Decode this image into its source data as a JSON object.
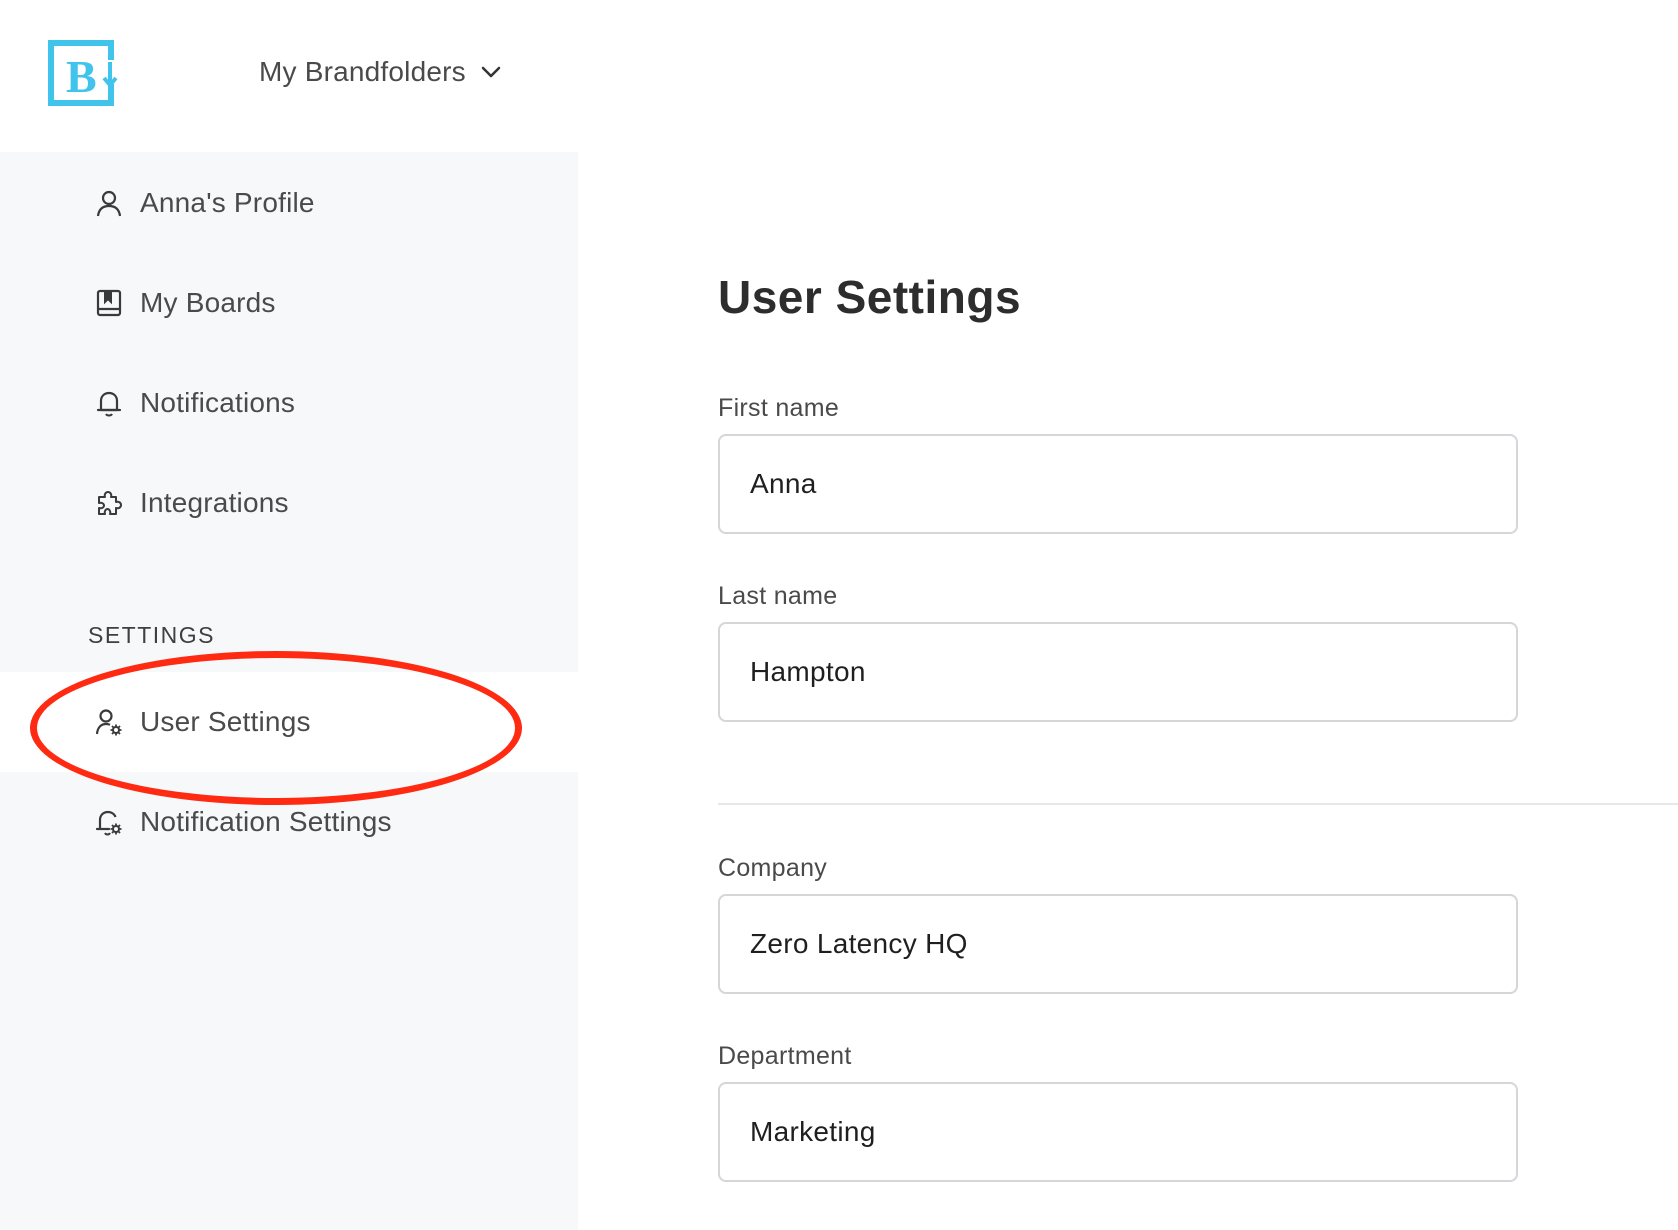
{
  "header": {
    "brand_switcher_label": "My Brandfolders"
  },
  "sidebar": {
    "items": [
      {
        "label": "Anna's Profile",
        "icon": "user-icon"
      },
      {
        "label": "My Boards",
        "icon": "board-icon"
      },
      {
        "label": "Notifications",
        "icon": "bell-icon"
      },
      {
        "label": "Integrations",
        "icon": "puzzle-icon"
      }
    ],
    "section_label": "SETTINGS",
    "settings_items": [
      {
        "label": "User Settings",
        "icon": "user-gear-icon",
        "active": true
      },
      {
        "label": "Notification Settings",
        "icon": "bell-gear-icon"
      }
    ]
  },
  "main": {
    "title": "User Settings",
    "fields": [
      {
        "label": "First name",
        "value": "Anna"
      },
      {
        "label": "Last name",
        "value": "Hampton"
      },
      {
        "label": "Company",
        "value": "Zero Latency HQ"
      },
      {
        "label": "Department",
        "value": "Marketing"
      }
    ]
  },
  "colors": {
    "brand_accent": "#40c4ec",
    "sidebar_bg": "#f7f8fa",
    "highlight_ring": "#ff2a12"
  }
}
